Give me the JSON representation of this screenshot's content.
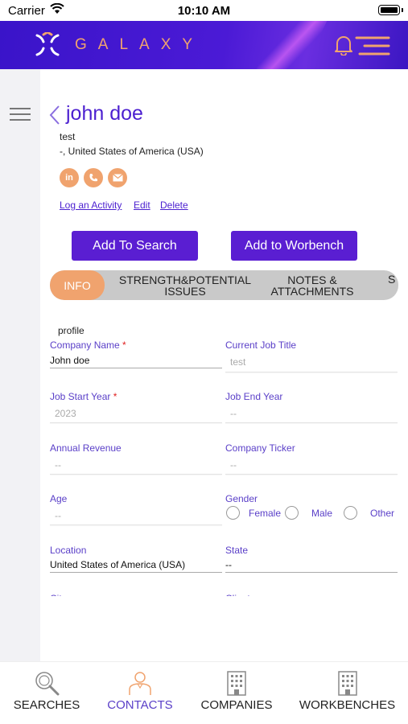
{
  "status_bar": {
    "carrier": "Carrier",
    "time": "10:10 AM"
  },
  "header": {
    "brand": "GALAXY"
  },
  "contact": {
    "name": "john doe",
    "subtitle": "test",
    "location": "-, United States of America (USA)",
    "social": [
      "in",
      "phone",
      "email"
    ],
    "actions": {
      "log_activity": "Log an Activity",
      "edit": "Edit",
      "delete": "Delete"
    }
  },
  "buttons": {
    "add_to_search": "Add To Search",
    "add_to_workbench": "Add to Worbench"
  },
  "tabs": [
    {
      "label": "INFO",
      "active": true
    },
    {
      "label": "STRENGTH&POTENTIAL ISSUES",
      "line1": "STRENGTH&POTENTIAL",
      "line2": "ISSUES"
    },
    {
      "label": "NOTES & ATTACHMENTS",
      "line1": "NOTES &",
      "line2": "ATTACHMENTS"
    },
    {
      "label": "S"
    }
  ],
  "form": {
    "section": "profile",
    "company_name": {
      "label": "Company Name",
      "required": "*",
      "value": "John doe"
    },
    "current_job_title": {
      "label": "Current Job Title",
      "placeholder": "test"
    },
    "job_start_year": {
      "label": "Job Start Year",
      "required": "*",
      "placeholder": "2023"
    },
    "job_end_year": {
      "label": "Job End Year",
      "placeholder": "--"
    },
    "annual_revenue": {
      "label": "Annual Revenue",
      "placeholder": "--"
    },
    "company_ticker": {
      "label": "Company Ticker",
      "placeholder": "--"
    },
    "age": {
      "label": "Age",
      "placeholder": "--"
    },
    "gender": {
      "label": "Gender",
      "options": [
        "Female",
        "Male",
        "Other"
      ]
    },
    "location": {
      "label": "Location",
      "value": "United States of America (USA)"
    },
    "state": {
      "label": "State",
      "value": "--"
    },
    "city": {
      "label": "City"
    },
    "client": {
      "label": "Client"
    }
  },
  "bottom_nav": [
    {
      "label": "SEARCHES",
      "icon": "search-icon"
    },
    {
      "label": "CONTACTS",
      "icon": "contacts-icon",
      "active": true
    },
    {
      "label": "COMPANIES",
      "icon": "building-icon"
    },
    {
      "label": "WORKBENCHES",
      "icon": "building-icon"
    }
  ],
  "colors": {
    "primary": "#5a1ed2",
    "accent": "#f0a36e",
    "label": "#5a3fc8"
  }
}
